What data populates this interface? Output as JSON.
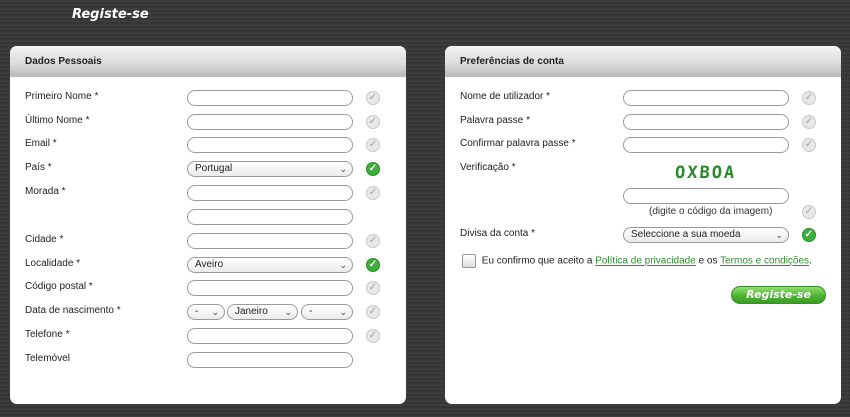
{
  "page_title": "Registe-se",
  "personal": {
    "title": "Dados Pessoais",
    "first_name": "Primeiro Nome *",
    "last_name": "Último Nome *",
    "email": "Email *",
    "country": "País *",
    "country_value": "Portugal",
    "address": "Morada *",
    "city": "Cidade *",
    "locality": "Localidade *",
    "locality_value": "Aveiro",
    "postal_code": "Código postal *",
    "birth_date": "Data de nascimento *",
    "day_value": "-",
    "month_value": "Janeiro",
    "year_value": "-",
    "phone": "Telefone *",
    "mobile": "Telemóvel"
  },
  "account": {
    "title": "Preferências de conta",
    "username": "Nome de utilizador *",
    "password": "Palavra passe *",
    "confirm_password": "Confirmar palavra passe *",
    "verification": "Verificação *",
    "captcha_text": "OXBOA",
    "captcha_hint": "(digite o código da imagem)",
    "currency": "Divisa da conta *",
    "currency_value": "Seleccione a sua moeda",
    "agree_prefix": "Eu confirmo que aceito a",
    "privacy_link": "Política de privacidade",
    "agree_middle": "e os",
    "terms_link": "Termos e condições",
    "agree_suffix": ".",
    "submit": "Registe-se"
  },
  "icons": {
    "check": "✓",
    "chevron": "⌄"
  },
  "colors": {
    "accent_green": "#3cb03c",
    "link_green": "#2f8f2f"
  }
}
